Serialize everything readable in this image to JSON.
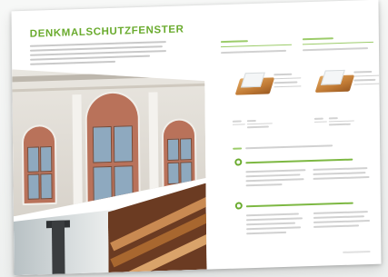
{
  "brochure": {
    "title": "DENKMALSCHUTZFENSTER"
  },
  "colors": {
    "accent": "#6aab2e",
    "window_frame": "#b9725a",
    "glass": "#8ea9bf",
    "wood": "#c98a52"
  },
  "images": {
    "facade": "arched-windows-facade-photo",
    "downpipe": "downpipe-photo",
    "profiles": "wood-profile-photo"
  }
}
